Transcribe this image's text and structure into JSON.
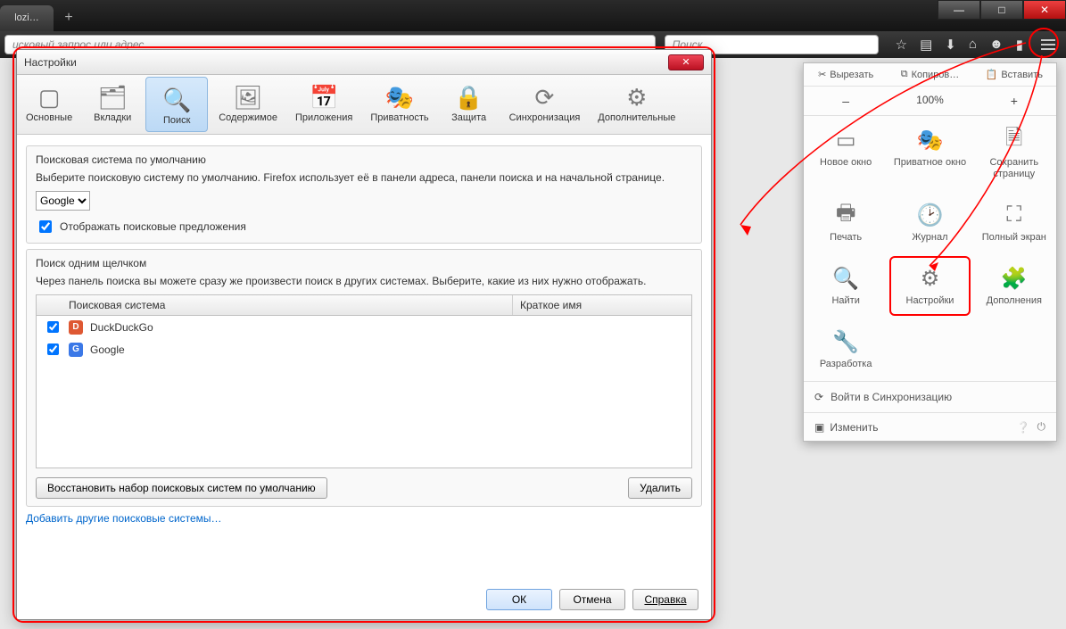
{
  "window": {
    "tab_title": "lozi…",
    "new_tab_glyph": "+",
    "min": "—",
    "max": "□",
    "close": "✕"
  },
  "toolbar": {
    "addr_placeholder": "исковый запрос или адрес",
    "search_placeholder": "Поиск"
  },
  "menu": {
    "cut": "Вырезать",
    "copy": "Копиров…",
    "paste": "Вставить",
    "zoom_minus": "–",
    "zoom_pct": "100%",
    "zoom_plus": "+",
    "items": [
      {
        "label": "Новое окно",
        "icon": "window"
      },
      {
        "label": "Приватное окно",
        "icon": "mask"
      },
      {
        "label": "Сохранить страницу",
        "icon": "save"
      },
      {
        "label": "Печать",
        "icon": "print"
      },
      {
        "label": "Журнал",
        "icon": "history"
      },
      {
        "label": "Полный экран",
        "icon": "fullscreen"
      },
      {
        "label": "Найти",
        "icon": "find"
      },
      {
        "label": "Настройки",
        "icon": "gear"
      },
      {
        "label": "Дополнения",
        "icon": "addons"
      },
      {
        "label": "Разработка",
        "icon": "dev"
      }
    ],
    "sync": "Войти в Синхронизацию",
    "customize": "Изменить"
  },
  "dialog": {
    "title": "Настройки",
    "tabs": [
      {
        "label": "Основные",
        "icon": "switch"
      },
      {
        "label": "Вкладки",
        "icon": "tabs"
      },
      {
        "label": "Поиск",
        "icon": "search"
      },
      {
        "label": "Содержимое",
        "icon": "content"
      },
      {
        "label": "Приложения",
        "icon": "apps"
      },
      {
        "label": "Приватность",
        "icon": "privacy"
      },
      {
        "label": "Защита",
        "icon": "security"
      },
      {
        "label": "Синхронизация",
        "icon": "sync"
      },
      {
        "label": "Дополнительные",
        "icon": "advanced"
      }
    ],
    "active_tab": 2,
    "default_engine": {
      "title": "Поисковая система по умолчанию",
      "desc": "Выберите поисковую систему по умолчанию. Firefox использует её в панели адреса, панели поиска и на начальной странице.",
      "selected": "Google",
      "suggestions_checkbox": "Отображать поисковые предложения",
      "suggestions_checked": true
    },
    "oneclick": {
      "title": "Поиск одним щелчком",
      "desc": "Через панель поиска вы можете сразу же произвести поиск в других системах. Выберите, какие из них нужно отображать.",
      "col1": "Поисковая система",
      "col2": "Краткое имя",
      "rows": [
        {
          "checked": true,
          "favicon": "ddg",
          "name": "DuckDuckGo"
        },
        {
          "checked": true,
          "favicon": "ggl",
          "name": "Google"
        }
      ],
      "restore": "Восстановить набор поисковых систем по умолчанию",
      "remove": "Удалить"
    },
    "add_more": "Добавить другие поисковые системы…",
    "ok": "ОК",
    "cancel": "Отмена",
    "help": "Справка"
  }
}
